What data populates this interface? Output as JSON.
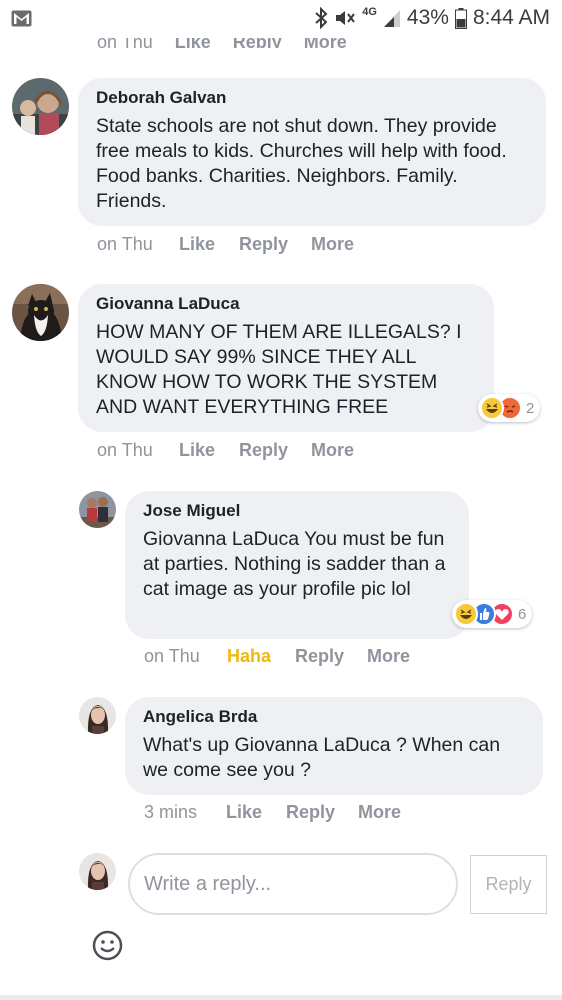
{
  "status_bar": {
    "network": "4G",
    "battery": "43%",
    "time": "8:44 AM"
  },
  "top_partial": {
    "time": "on Thu",
    "like": "Like",
    "reply": "Reply",
    "more": "More"
  },
  "comments": [
    {
      "author": "Deborah Galvan",
      "body": "State schools are not shut down. They provide free meals to kids. Churches will help with food. Food banks. Charities. Neighbors. Family. Friends.",
      "time": "on Thu",
      "like": "Like",
      "reply": "Reply",
      "more": "More"
    },
    {
      "author": "Giovanna LaDuca",
      "body": "HOW MANY OF THEM ARE ILLEGALS? I WOULD SAY 99% SINCE THEY ALL KNOW HOW TO WORK THE SYSTEM AND WANT EVERYTHING FREE",
      "time": "on Thu",
      "like": "Like",
      "reply": "Reply",
      "more": "More",
      "reactions": {
        "icons": [
          "haha-icon",
          "angry-icon"
        ],
        "count": "2"
      }
    },
    {
      "author": "Jose Miguel",
      "body": "Giovanna LaDuca You must be fun at parties. Nothing is sadder than a cat image as your profile pic lol",
      "time": "on Thu",
      "like": "Haha",
      "reply": "Reply",
      "more": "More",
      "reactions": {
        "icons": [
          "haha-icon",
          "like-icon",
          "love-icon"
        ],
        "count": "6"
      }
    },
    {
      "author": "Angelica Brda",
      "body": "What's up Giovanna LaDuca ? When can we come see you ?",
      "time": "3 mins",
      "like": "Like",
      "reply": "Reply",
      "more": "More"
    }
  ],
  "composer": {
    "placeholder": "Write a reply...",
    "button": "Reply",
    "emoji_icon": "smiley-icon"
  },
  "colors": {
    "bubble": "#eff0f3",
    "meta": "#90949c",
    "haha": "#f0b90b"
  }
}
